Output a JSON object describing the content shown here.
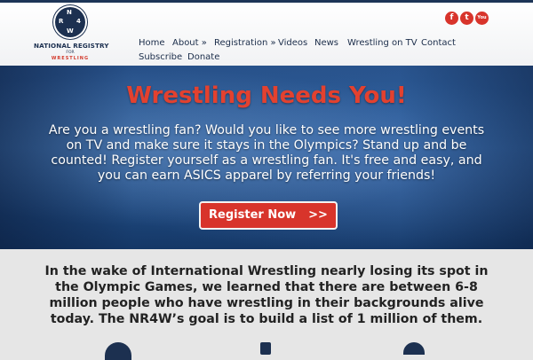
{
  "logo": {
    "seal_letters": [
      "N",
      "R",
      "4",
      "W"
    ],
    "line1": "NATIONAL REGISTRY",
    "line2": "FOR",
    "line3": "WRESTLING"
  },
  "social": [
    {
      "name": "facebook",
      "glyph": "f"
    },
    {
      "name": "twitter",
      "glyph": "t"
    },
    {
      "name": "youtube",
      "glyph": "You"
    }
  ],
  "nav": {
    "items": [
      {
        "label": "Home"
      },
      {
        "label": "About »"
      },
      {
        "label": "Registration »"
      },
      {
        "label": "Videos"
      },
      {
        "label": "News"
      },
      {
        "label": "Wrestling on TV"
      },
      {
        "label": "Contact"
      },
      {
        "label": "Subscribe"
      },
      {
        "label": "Donate"
      }
    ]
  },
  "hero": {
    "title": "Wrestling Needs You!",
    "body": "Are you a wrestling fan? Would you like to see more wrestling events on TV and make sure it stays in the Olympics? Stand up and be counted! Register yourself as a wrestling fan. It's free and easy, and you can earn ASICS apparel by referring your friends!",
    "cta_label": "Register Now",
    "cta_arrow": ">>"
  },
  "intro": {
    "text": "In the wake of International Wrestling nearly losing its spot in the Olympic Games, we learned that there are between 6-8 million people who have wrestling in their backgrounds alive today. The NR4W’s goal is to build a list of 1 million of them."
  },
  "colors": {
    "brand_navy": "#1c3050",
    "accent_red": "#d8342b",
    "title_red": "#e3412f"
  }
}
